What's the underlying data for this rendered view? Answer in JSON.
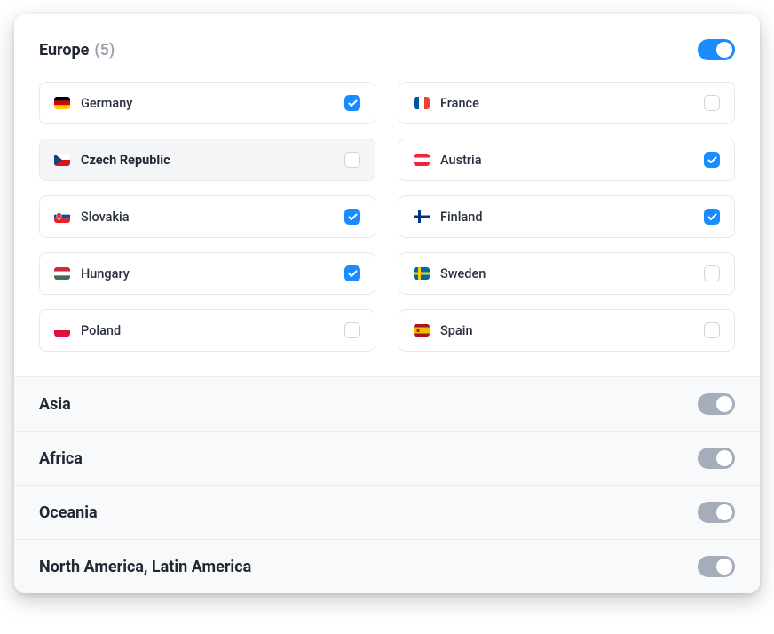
{
  "regions": [
    {
      "id": "europe",
      "name": "Europe",
      "count": 5,
      "enabled": true,
      "expanded": true,
      "countries": [
        {
          "id": "germany",
          "name": "Germany",
          "flag": "de",
          "checked": true,
          "hover": false
        },
        {
          "id": "france",
          "name": "France",
          "flag": "fr",
          "checked": false,
          "hover": false
        },
        {
          "id": "czech",
          "name": "Czech Republic",
          "flag": "cz",
          "checked": false,
          "hover": true
        },
        {
          "id": "austria",
          "name": "Austria",
          "flag": "at",
          "checked": true,
          "hover": false
        },
        {
          "id": "slovakia",
          "name": "Slovakia",
          "flag": "sk",
          "checked": true,
          "hover": false
        },
        {
          "id": "finland",
          "name": "Finland",
          "flag": "fi",
          "checked": true,
          "hover": false
        },
        {
          "id": "hungary",
          "name": "Hungary",
          "flag": "hu",
          "checked": true,
          "hover": false
        },
        {
          "id": "sweden",
          "name": "Sweden",
          "flag": "se",
          "checked": false,
          "hover": false
        },
        {
          "id": "poland",
          "name": "Poland",
          "flag": "pl",
          "checked": false,
          "hover": false
        },
        {
          "id": "spain",
          "name": "Spain",
          "flag": "es",
          "checked": false,
          "hover": false
        }
      ]
    },
    {
      "id": "asia",
      "name": "Asia",
      "enabled": false,
      "expanded": false
    },
    {
      "id": "africa",
      "name": "Africa",
      "enabled": false,
      "expanded": false
    },
    {
      "id": "oceania",
      "name": "Oceania",
      "enabled": false,
      "expanded": false
    },
    {
      "id": "americas",
      "name": "North America, Latin America",
      "enabled": false,
      "expanded": false
    }
  ]
}
